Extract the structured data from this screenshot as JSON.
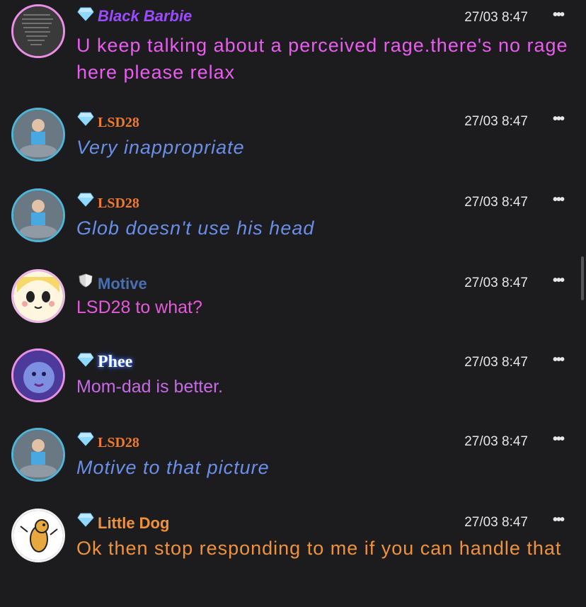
{
  "colors": {
    "background": "#1c1c1e",
    "time": "#e6e6e6"
  },
  "messages": [
    {
      "user": "Black Barbie",
      "badge": "diamond-icon",
      "time": "27/03 8:47",
      "text": "U keep talking about a perceived rage.there's no rage here please relax",
      "name_color": "#9b4cff",
      "text_color": "#ea5cf0"
    },
    {
      "user": "LSD28",
      "badge": "diamond-icon",
      "time": "27/03 8:47",
      "text": "Very inappropriate",
      "name_color": "#f07a2c",
      "text_color": "#6a8fe8"
    },
    {
      "user": "LSD28",
      "badge": "diamond-icon",
      "time": "27/03 8:47",
      "text": "Glob doesn't use his head",
      "name_color": "#f07a2c",
      "text_color": "#6a8fe8"
    },
    {
      "user": "Motive",
      "badge": "shield-icon",
      "time": "27/03 8:47",
      "text": "LSD28 to what?",
      "name_color": "#4a6fb0",
      "text_color": "#e45ad8"
    },
    {
      "user": "Phee",
      "badge": "diamond-icon",
      "time": "27/03 8:47",
      "text": "Mom-dad is better.",
      "name_color": "#ffffff",
      "text_color": "#c86ae6"
    },
    {
      "user": "LSD28",
      "badge": "diamond-icon",
      "time": "27/03 8:47",
      "text": "Motive to that picture",
      "name_color": "#f07a2c",
      "text_color": "#6a8fe8"
    },
    {
      "user": "Little Dog",
      "badge": "diamond-icon",
      "time": "27/03 8:47",
      "text": "Ok then stop responding to me if you can handle that",
      "name_color": "#f0923a",
      "text_color": "#f0923a"
    }
  ]
}
